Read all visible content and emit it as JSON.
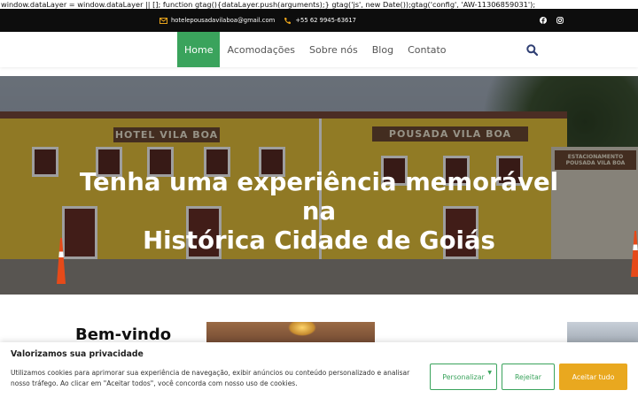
{
  "script_leak": "window.dataLayer = window.dataLayer || []; function gtag(){dataLayer.push(arguments);} gtag('js', new Date());gtag('config', 'AW-11306859031');",
  "topbar": {
    "email": "hotelepousadavilaboa@gmail.com",
    "phone": "+55 62 9945-63617",
    "email_icon": "envelope-icon",
    "phone_icon": "phone-icon",
    "social": [
      "facebook-icon",
      "instagram-icon"
    ],
    "accent_color": "#e8a31c"
  },
  "nav": {
    "items": [
      {
        "label": "Home",
        "active": true
      },
      {
        "label": "Acomodações",
        "active": false
      },
      {
        "label": "Sobre nós",
        "active": false
      },
      {
        "label": "Blog",
        "active": false
      },
      {
        "label": "Contato",
        "active": false
      }
    ],
    "search_icon": "search-icon",
    "active_color": "#3aa35c"
  },
  "hero": {
    "title_line1": "Tenha uma experiência memorável",
    "title_line2": "na",
    "title_line3": "Histórica Cidade de Goiás",
    "sign_left": "HOTEL VILA BOA",
    "sign_right": "POUSADA VILA BOA",
    "sign_far_right": "ESTACIONAMENTO POUSADA VILA BOA"
  },
  "welcome": {
    "heading": "Bem-vindo"
  },
  "cookie": {
    "title": "Valorizamos sua privacidade",
    "text": "Utilizamos cookies para aprimorar sua experiência de navegação, exibir anúncios ou conteúdo personalizado e analisar nosso tráfego. Ao clicar em \"Aceitar todos\", você concorda com nosso uso de cookies.",
    "customize_label": "Personalizar",
    "reject_label": "Rejeitar",
    "accept_label": "Aceitar tudo",
    "accept_color": "#e9a81f"
  }
}
